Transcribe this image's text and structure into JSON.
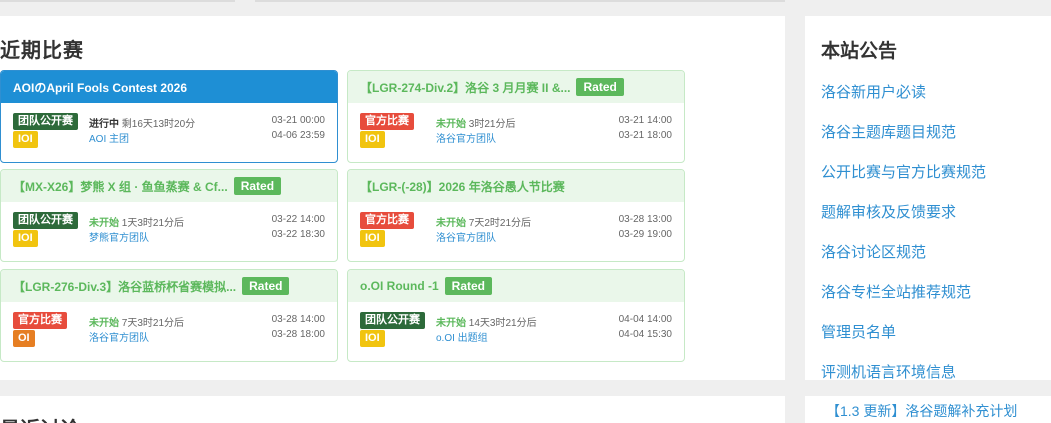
{
  "main": {
    "section_title": "近期比赛",
    "next_section_title": "最近讨论",
    "contests": [
      {
        "title": "AOIのApril Fools Contest 2026",
        "rated": "",
        "type_tag": "团队公开赛",
        "rule_tag": "IOI",
        "status": "进行中",
        "remaining": "剩16天13时20分",
        "host": "AOI 主团",
        "start": "03-21 00:00",
        "end": "04-06 23:59",
        "active": true
      },
      {
        "title": "【LGR-274-Div.2】洛谷 3 月月赛 II &...",
        "rated": "Rated",
        "type_tag": "官方比赛",
        "rule_tag": "IOI",
        "status": "未开始",
        "remaining": "3时21分后",
        "host": "洛谷官方团队",
        "start": "03-21 14:00",
        "end": "03-21 18:00",
        "active": false
      },
      {
        "title": "【MX-X26】梦熊 X 组 · 鱼鱼蒸赛 & Cf...",
        "rated": "Rated",
        "type_tag": "团队公开赛",
        "rule_tag": "IOI",
        "status": "未开始",
        "remaining": "1天3时21分后",
        "host": "梦熊官方团队",
        "start": "03-22 14:00",
        "end": "03-22 18:30",
        "active": false
      },
      {
        "title": "【LGR-(-28)】2026 年洛谷愚人节比赛",
        "rated": "",
        "type_tag": "官方比赛",
        "rule_tag": "IOI",
        "status": "未开始",
        "remaining": "7天2时21分后",
        "host": "洛谷官方团队",
        "start": "03-28 13:00",
        "end": "03-29 19:00",
        "active": false
      },
      {
        "title": "【LGR-276-Div.3】洛谷蓝桥杯省赛模拟...",
        "rated": "Rated",
        "type_tag": "官方比赛",
        "rule_tag": "OI",
        "status": "未开始",
        "remaining": "7天3时21分后",
        "host": "洛谷官方团队",
        "start": "03-28 14:00",
        "end": "03-28 18:00",
        "active": false
      },
      {
        "title": "o.OI Round -1",
        "rated": "Rated",
        "type_tag": "团队公开赛",
        "rule_tag": "IOI",
        "status": "未开始",
        "remaining": "14天3时21分后",
        "host": "o.OI 出题组",
        "start": "04-04 14:00",
        "end": "04-04 15:30",
        "active": false
      }
    ]
  },
  "sidebar": {
    "title": "本站公告",
    "notices": [
      "洛谷新用户必读",
      "洛谷主题库题目规范",
      "公开比赛与官方比赛规范",
      "题解审核及反馈要求",
      "洛谷讨论区规范",
      "洛谷专栏全站推荐规范",
      "管理员名单",
      "评测机语言环境信息",
      "【1.3 更新】洛谷题解补充计划"
    ]
  },
  "colors": {
    "accent": "#2f8fd1",
    "rated": "#5cb85c",
    "official": "#e74c3c",
    "team": "#2d6a3a",
    "ioi": "#f1c40f",
    "oi": "#e67e22"
  }
}
